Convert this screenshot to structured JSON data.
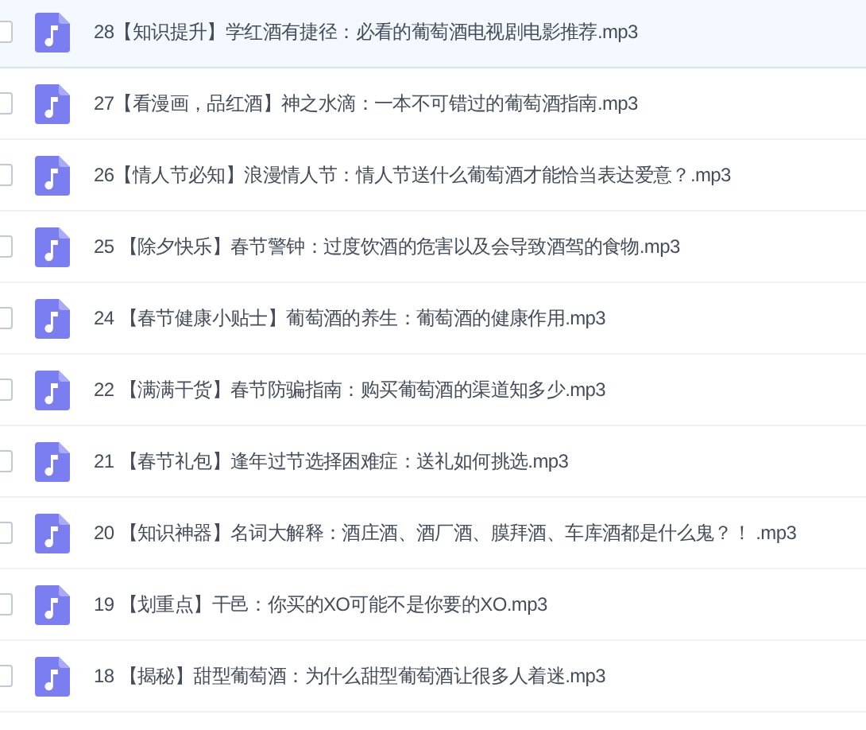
{
  "files": [
    {
      "name": "28【知识提升】学红酒有捷径：必看的葡萄酒电视剧电影推荐.mp3",
      "selected": true,
      "checked": false
    },
    {
      "name": "27【看漫画，品红酒】神之水滴：一本不可错过的葡萄酒指南.mp3",
      "selected": false,
      "checked": false
    },
    {
      "name": "26【情人节必知】浪漫情人节：情人节送什么葡萄酒才能恰当表达爱意？.mp3",
      "selected": false,
      "checked": false
    },
    {
      "name": "25 【除夕快乐】春节警钟：过度饮酒的危害以及会导致酒驾的食物.mp3",
      "selected": false,
      "checked": false
    },
    {
      "name": "24 【春节健康小贴士】葡萄酒的养生：葡萄酒的健康作用.mp3",
      "selected": false,
      "checked": false
    },
    {
      "name": "22 【满满干货】春节防骗指南：购买葡萄酒的渠道知多少.mp3",
      "selected": false,
      "checked": false
    },
    {
      "name": "21 【春节礼包】逢年过节选择困难症：送礼如何挑选.mp3",
      "selected": false,
      "checked": false
    },
    {
      "name": "20 【知识神器】名词大解释：酒庄酒、酒厂酒、膜拜酒、车库酒都是什么鬼？！ .mp3",
      "selected": false,
      "checked": false
    },
    {
      "name": "19 【划重点】干邑：你买的XO可能不是你要的XO.mp3",
      "selected": false,
      "checked": false
    },
    {
      "name": "18 【揭秘】甜型葡萄酒：为什么甜型葡萄酒让很多人着迷.mp3",
      "selected": false,
      "checked": false
    }
  ]
}
